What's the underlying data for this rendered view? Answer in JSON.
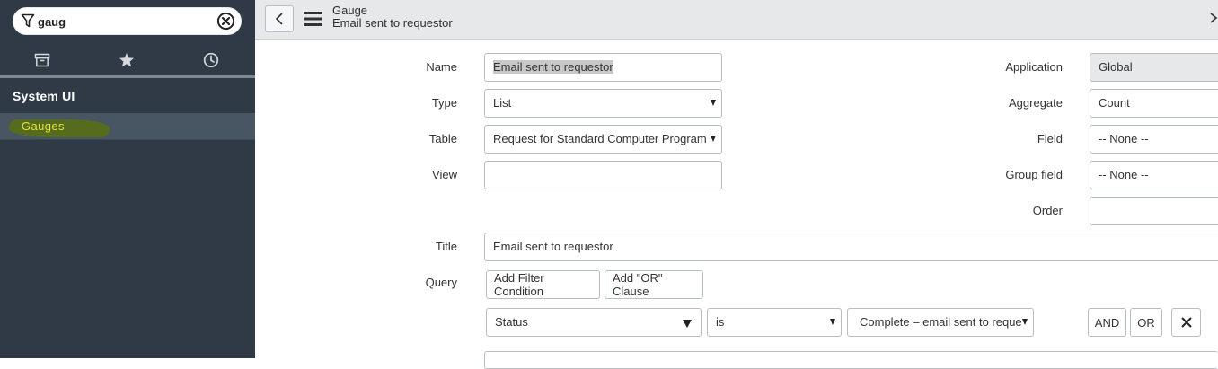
{
  "navigator": {
    "filter_value": "gaug",
    "tabs": [
      {
        "name": "all-applications",
        "icon": "archive-icon"
      },
      {
        "name": "favorites",
        "icon": "star-icon"
      },
      {
        "name": "history",
        "icon": "clock-icon"
      }
    ],
    "section_title": "System UI",
    "module_label": "Gauges",
    "highlight_color": "#566d1a"
  },
  "header": {
    "title": "Gauge",
    "subtitle": "Email sent to requestor"
  },
  "form": {
    "name": {
      "label": "Name",
      "value": "Email sent to requestor"
    },
    "type": {
      "label": "Type",
      "value": "List"
    },
    "table": {
      "label": "Table",
      "value": "Request for Standard Computer Program"
    },
    "view": {
      "label": "View",
      "value": ""
    },
    "application": {
      "label": "Application",
      "value": "Global"
    },
    "aggregate": {
      "label": "Aggregate",
      "value": "Count"
    },
    "field": {
      "label": "Field",
      "value": "-- None --"
    },
    "group_field": {
      "label": "Group field",
      "value": "-- None --"
    },
    "order": {
      "label": "Order",
      "value": ""
    },
    "title": {
      "label": "Title",
      "value": "Email sent to requestor"
    },
    "query": {
      "label": "Query",
      "add_filter_label": "Add Filter Condition",
      "add_or_label": "Add \"OR\" Clause",
      "condition": {
        "field": "Status",
        "operator": "is",
        "value": "Complete – email sent to reque"
      },
      "and_label": "AND",
      "or_label": "OR"
    }
  }
}
